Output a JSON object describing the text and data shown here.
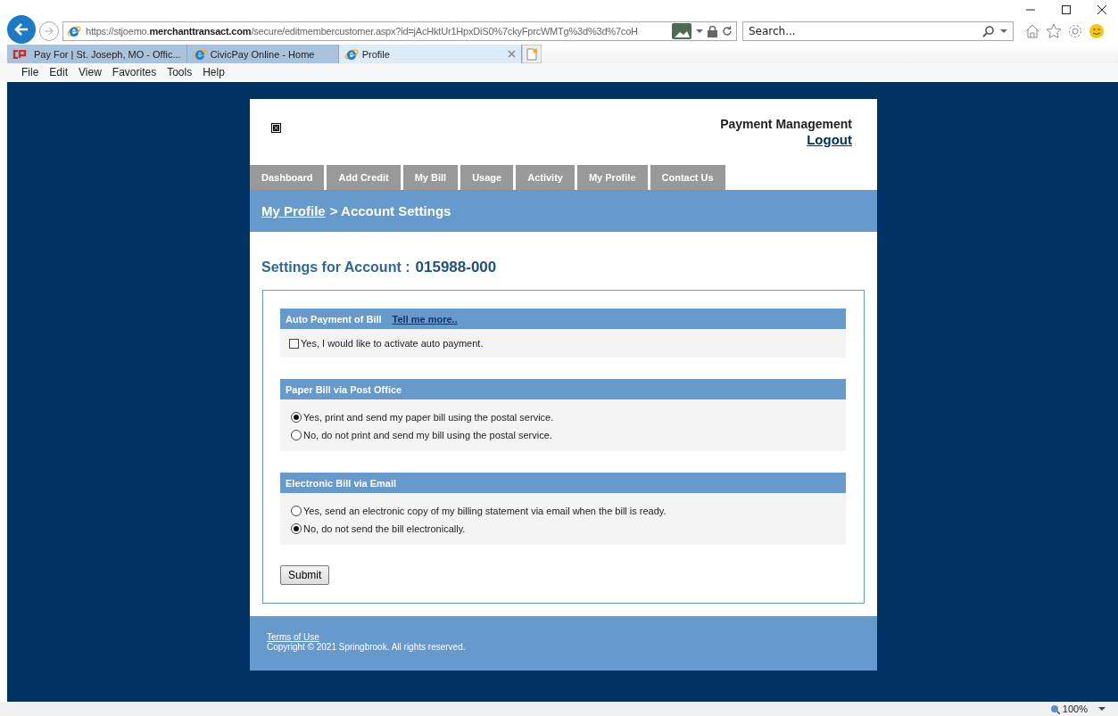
{
  "browser": {
    "address": "https://stjoemo.**merchanttransact.com**/secure/editmembercustomer.aspx?id=jAcHktUr1HpxDiS0%7ckyFprcWMTg%3d%3d%7coH",
    "search": {
      "placeholder": "Search..."
    },
    "tabs": [
      {
        "label": "Pay For | St. Joseph, MO - Offic...",
        "kind": "cp",
        "selected": false
      },
      {
        "label": "CivicPay Online - Home",
        "kind": "ie",
        "selected": false
      },
      {
        "label": "Profile",
        "kind": "ie",
        "selected": true
      }
    ],
    "menu": [
      "File",
      "Edit",
      "View",
      "Favorites",
      "Tools",
      "Help"
    ],
    "zoom": "100%"
  },
  "site": {
    "title": "Payment Management",
    "logout": "Logout",
    "nav": [
      {
        "label": "Dashboard",
        "selected": false
      },
      {
        "label": "Add Credit",
        "selected": false
      },
      {
        "label": "My Bill",
        "selected": false
      },
      {
        "label": "Usage",
        "selected": false
      },
      {
        "label": "Activity",
        "selected": false
      },
      {
        "label": "My Profile",
        "selected": false
      },
      {
        "label": "Contact Us",
        "selected": false
      }
    ],
    "breadcrumb": {
      "link": "My Profile",
      "current": "> Account Settings"
    },
    "heading": "Settings for Account :",
    "account": "015988-000",
    "sections": [
      {
        "title": "Auto Payment of Bill",
        "link": "Tell me more..",
        "options": [
          {
            "kind": "checkbox",
            "label": "Yes, I would like to activate auto payment.",
            "checked": false
          }
        ]
      },
      {
        "title": "Paper Bill via Post Office",
        "options": [
          {
            "kind": "radio",
            "label": "Yes, print and send my paper bill using the postal service.",
            "checked": true
          },
          {
            "kind": "radio",
            "label": "No, do not print and send my bill using the postal service.",
            "checked": false
          }
        ]
      },
      {
        "title": "Electronic Bill via Email",
        "options": [
          {
            "kind": "radio",
            "label": "Yes, send an electronic copy of my billing statement via email when the bill is ready.",
            "checked": false
          },
          {
            "kind": "radio",
            "label": "No, do not send the bill electronically.",
            "checked": true
          }
        ]
      }
    ],
    "submit": "Submit",
    "footer": {
      "terms": "Terms of Use",
      "copyright": "Copyright © 2021 Springbrook. All rights reserved."
    }
  }
}
